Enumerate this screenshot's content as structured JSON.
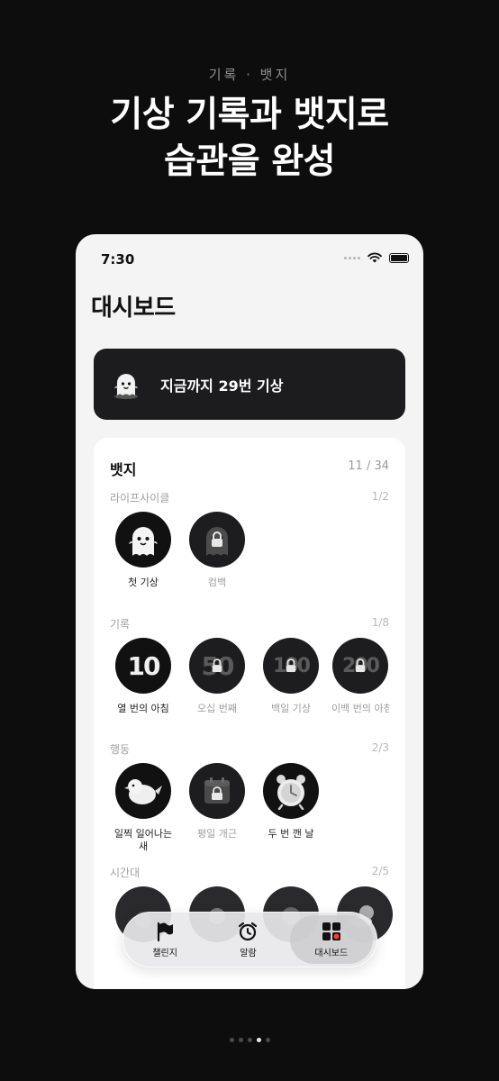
{
  "promo": {
    "kicker": "기록 · 뱃지",
    "headline_line1": "기상 기록과 뱃지로",
    "headline_line2": "습관을 완성"
  },
  "status_bar": {
    "time": "7:30"
  },
  "dashboard": {
    "title": "대시보드",
    "summary": "지금까지 29번 기상",
    "badges": {
      "title": "뱃지",
      "count": "11 / 34",
      "sections": [
        {
          "title": "라이프사이클",
          "count": "1/2",
          "items": [
            {
              "label": "첫 기상",
              "icon": "ghost-icon",
              "locked": false
            },
            {
              "label": "컴백",
              "icon": "ghost-icon",
              "locked": true
            }
          ]
        },
        {
          "title": "기록",
          "count": "1/8",
          "items": [
            {
              "label": "열 번의 아침",
              "art": "10",
              "locked": false
            },
            {
              "label": "오십 번째",
              "art": "50",
              "locked": true
            },
            {
              "label": "백일 기상",
              "art": "100",
              "locked": true
            },
            {
              "label": "이백 번의 아침",
              "art": "200",
              "locked": true
            }
          ]
        },
        {
          "title": "행동",
          "count": "2/3",
          "items": [
            {
              "label": "일찍 일어나는 새",
              "icon": "bird-icon",
              "locked": false
            },
            {
              "label": "평일 개근",
              "icon": "calendar-icon",
              "locked": true
            },
            {
              "label": "두 번 깬 날",
              "icon": "alarm-clock-icon",
              "locked": false
            }
          ]
        },
        {
          "title": "시간대",
          "count": "2/5"
        }
      ]
    }
  },
  "tabbar": {
    "items": [
      {
        "label": "챌린지",
        "icon": "flag-icon"
      },
      {
        "label": "알람",
        "icon": "alarm-icon"
      },
      {
        "label": "대시보드",
        "icon": "grid-icon",
        "active": true
      }
    ]
  },
  "pager": {
    "total": 5,
    "current": 4
  }
}
